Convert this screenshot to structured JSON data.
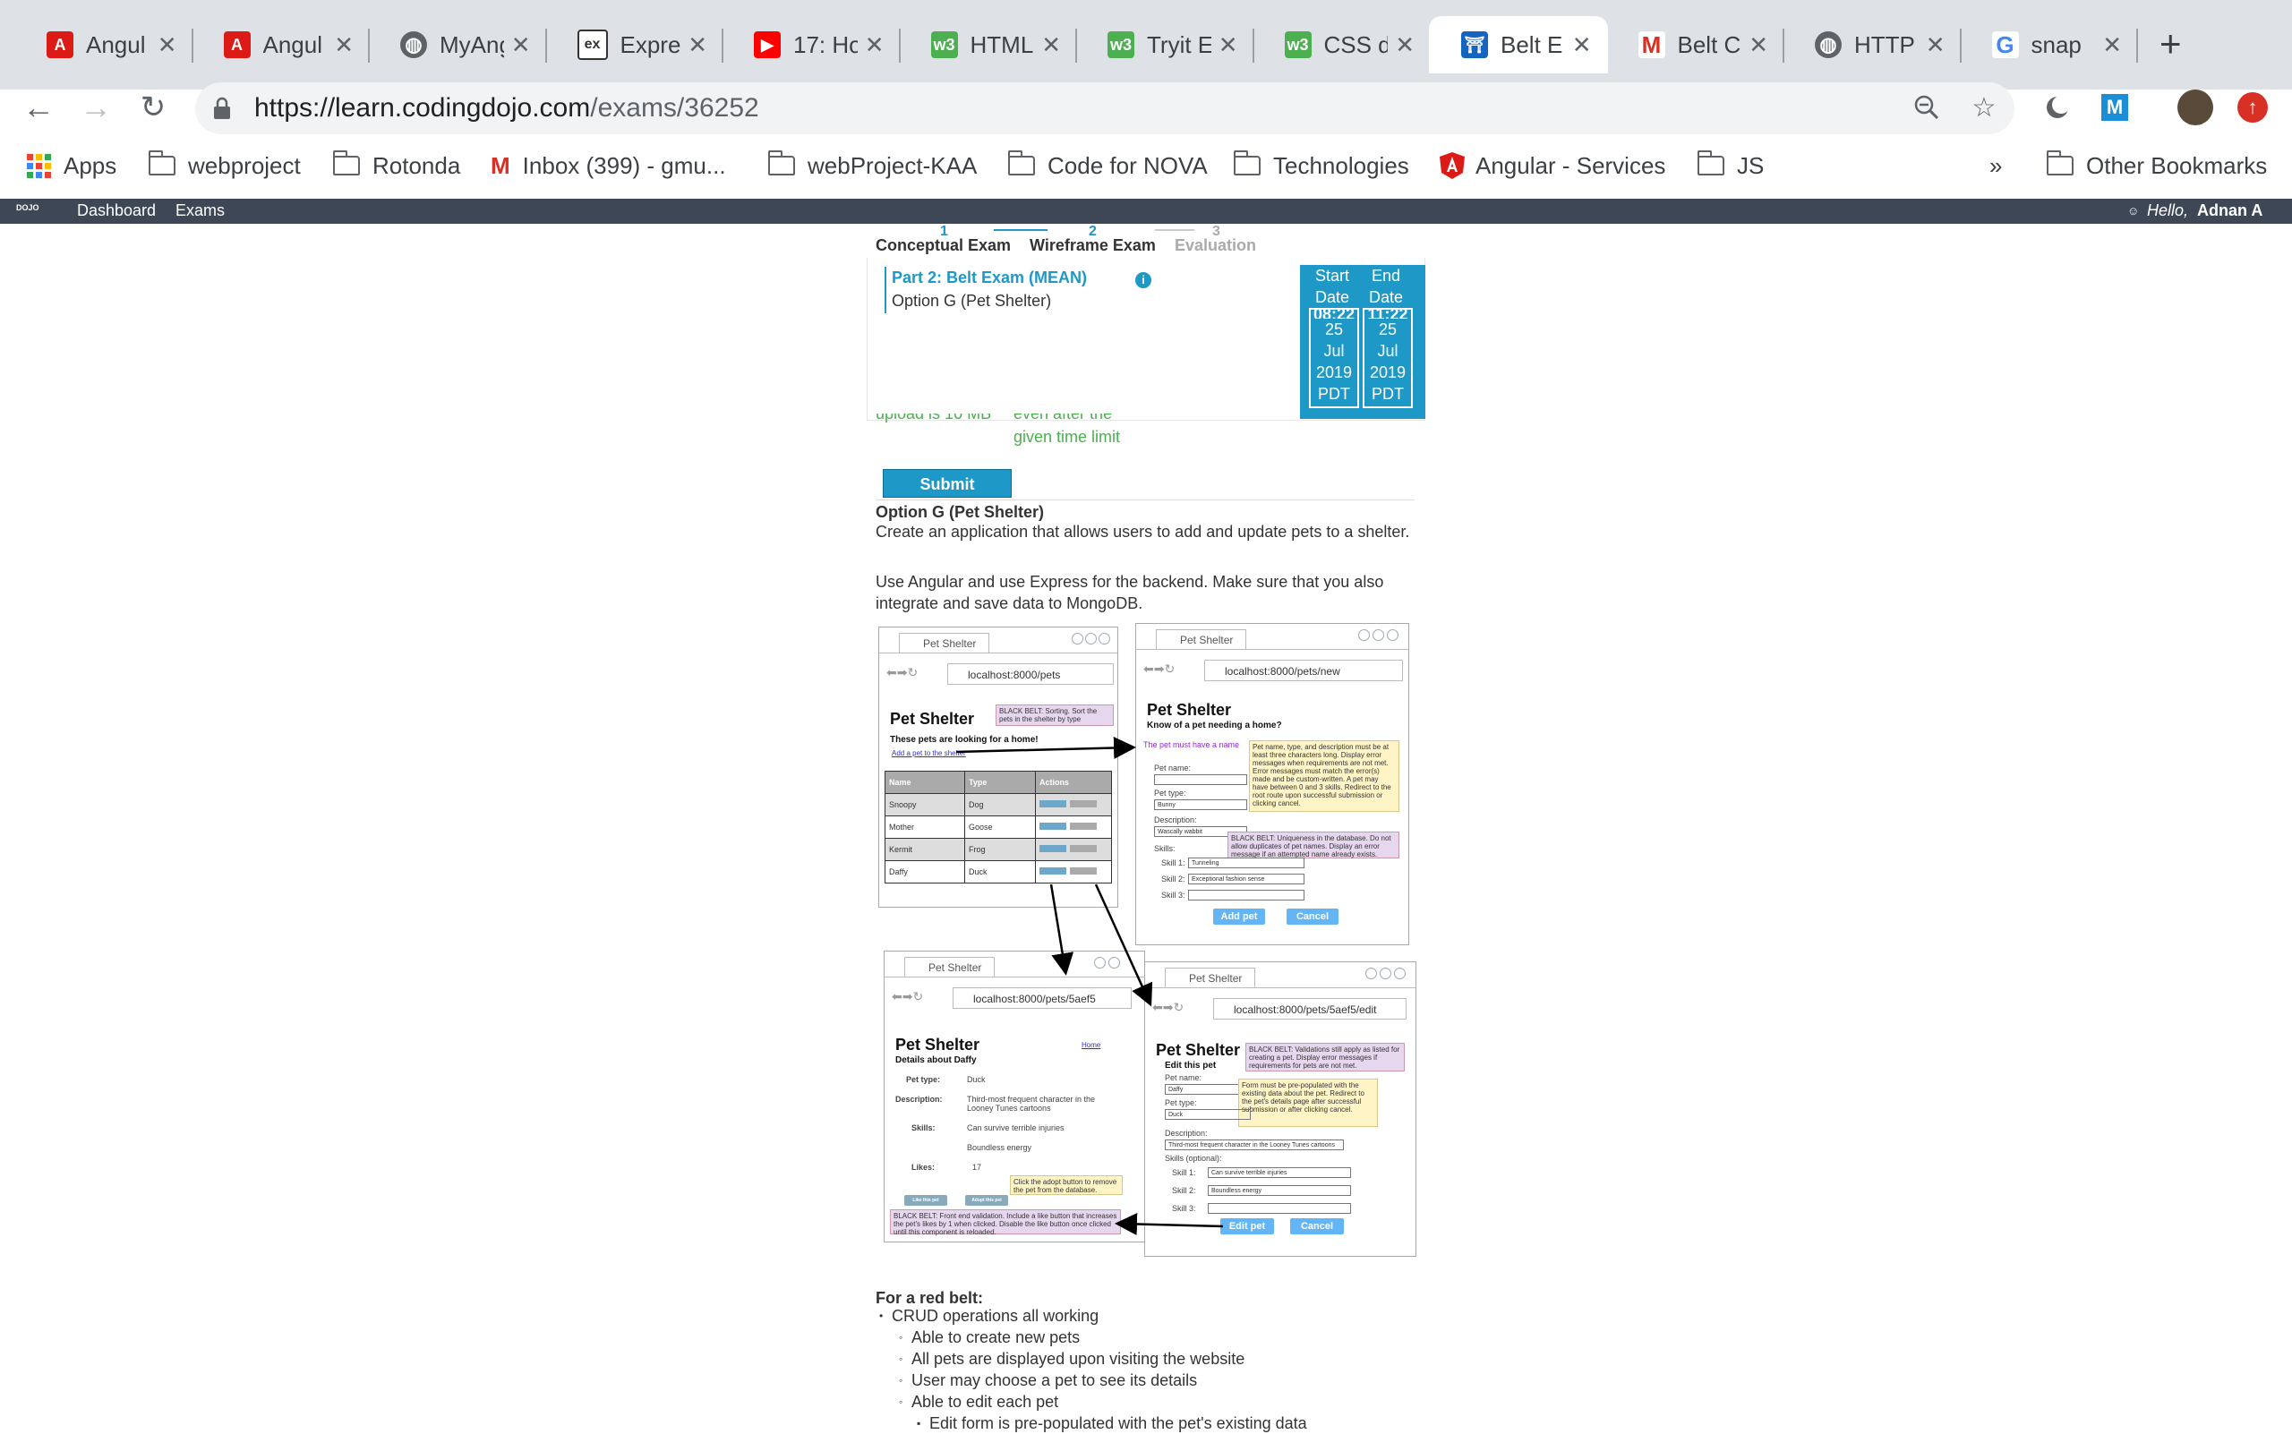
{
  "browser": {
    "tabs": [
      {
        "label": "Angul",
        "icon": "angular-icon"
      },
      {
        "label": "Angul",
        "icon": "angular-icon"
      },
      {
        "label": "MyAng",
        "icon": "globe-icon"
      },
      {
        "label": "Expre",
        "icon": "express-icon"
      },
      {
        "label": "17: Ho",
        "icon": "youtube-icon"
      },
      {
        "label": "HTML",
        "icon": "w3schools-icon"
      },
      {
        "label": "Tryit E",
        "icon": "w3schools-icon"
      },
      {
        "label": "CSS d",
        "icon": "w3schools-icon"
      },
      {
        "label": "Belt E",
        "icon": "codingdojo-icon",
        "active": true
      },
      {
        "label": "Belt C",
        "icon": "gmail-icon"
      },
      {
        "label": "HTTP",
        "icon": "globe-icon"
      },
      {
        "label": "snap",
        "icon": "google-icon"
      }
    ],
    "url": {
      "base": "https://learn.codingdojo.com",
      "path": "/exams/36252"
    },
    "bookmarks": [
      {
        "label": "Apps",
        "icon": "apps-grid-icon"
      },
      {
        "label": "webproject",
        "icon": "folder-icon"
      },
      {
        "label": "Rotonda",
        "icon": "folder-icon"
      },
      {
        "label": "Inbox (399) - gmu...",
        "icon": "gmail-icon"
      },
      {
        "label": "webProject-KAA",
        "icon": "folder-icon"
      },
      {
        "label": "Code for NOVA",
        "icon": "folder-icon"
      },
      {
        "label": "Technologies",
        "icon": "folder-icon"
      },
      {
        "label": "Angular - Services",
        "icon": "angular-icon"
      },
      {
        "label": "JS",
        "icon": "folder-icon"
      }
    ],
    "bookmarks_overflow": "»",
    "other_bookmarks": "Other Bookmarks"
  },
  "appnav": {
    "logo_text": "DOJO",
    "links": [
      "Dashboard",
      "Exams"
    ],
    "greeting": "Hello,",
    "user": "Adnan A"
  },
  "exam": {
    "steps": [
      {
        "num": "1",
        "label": "Conceptual Exam"
      },
      {
        "num": "2",
        "label": "Wireframe Exam"
      },
      {
        "num": "3",
        "label": "Evaluation"
      }
    ],
    "part": "Part 2: Belt Exam (MEAN)",
    "option": "Option G (Pet Shelter)",
    "dates": {
      "start_label_1": "Start",
      "start_label_2": "Date",
      "end_label_1": "End",
      "end_label_2": "Date",
      "start_time": "08:22",
      "end_time": "11:22",
      "start": [
        "25",
        "Jul",
        "2019",
        "PDT"
      ],
      "end": [
        "25",
        "Jul",
        "2019",
        "PDT"
      ]
    },
    "upload_note": "upload is 10 MB",
    "time_note_1": "even after the",
    "time_note_2": "given time limit",
    "submit_label": "Submit",
    "heading": "Option G (Pet Shelter)",
    "desc1": "Create an application that allows users to add and update pets to a shelter.",
    "desc2": "Use Angular and use Express for the backend. Make sure that you also integrate and save data to MongoDB.",
    "red_belt_title": "For a red belt:",
    "red_belt": [
      {
        "level": 1,
        "text": "CRUD operations all working"
      },
      {
        "level": 2,
        "text": "Able to create new pets"
      },
      {
        "level": 2,
        "text": "All pets are displayed upon visiting the website"
      },
      {
        "level": 2,
        "text": "User may choose a pet to see its details"
      },
      {
        "level": 2,
        "text": "Able to edit each pet"
      },
      {
        "level": 3,
        "text": "Edit form is pre-populated with the pet's existing data"
      }
    ]
  },
  "wireframes": {
    "tab_title": "Pet Shelter",
    "list": {
      "url": "localhost:8000/pets",
      "title": "Pet Shelter",
      "subtitle": "These pets are looking for a home!",
      "link": "Add a pet to the shelter",
      "note": "BLACK BELT: Sorting. Sort the pets in the shelter by type",
      "headers": [
        "Name",
        "Type",
        "Actions"
      ],
      "rows": [
        [
          "Snoopy",
          "Dog"
        ],
        [
          "Mother",
          "Goose"
        ],
        [
          "Kermit",
          "Frog"
        ],
        [
          "Daffy",
          "Duck"
        ]
      ]
    },
    "new": {
      "url": "localhost:8000/pets/new",
      "title": "Pet Shelter",
      "subtitle": "Know of a pet needing a home?",
      "error": "The pet must have a name",
      "note_yellow": "Pet name, type, and description must be at least three characters long. Display error messages when requirements are not met. Error messages must match the error(s) made and be custom-written. A pet may have between 0 and 3 skills. Redirect to the root route upon successful submission or clicking cancel.",
      "note_purple": "BLACK BELT: Uniqueness in the database. Do not allow duplicates of pet names. Display an error message if an attempted name already exists.",
      "labels": [
        "Pet name:",
        "Pet type:",
        "Description:",
        "Skills:",
        "Skill 1:",
        "Skill 2:",
        "Skill 3:"
      ],
      "values": [
        "",
        "Bunny",
        "Wascally wabbit",
        "Tunneling",
        "Exceptional fashion sense"
      ],
      "add_btn": "Add pet",
      "cancel_btn": "Cancel"
    },
    "details": {
      "url": "localhost:8000/pets/5aef5",
      "title": "Pet Shelter",
      "home": "Home",
      "subtitle": "Details about Daffy",
      "fields": [
        {
          "k": "Pet type:",
          "v": "Duck"
        },
        {
          "k": "Description:",
          "v": "Third-most frequent character in the Looney Tunes cartoons"
        },
        {
          "k": "Skills:",
          "v": "Can survive terrible injuries"
        },
        {
          "k": "",
          "v": "Boundless energy"
        },
        {
          "k": "Likes:",
          "v": "17"
        }
      ],
      "like_btn": "Like this pet",
      "adopt_btn": "Adopt this pet",
      "note_yellow": "Click the adopt button to remove the pet from the database.",
      "note_purple": "BLACK BELT: Front end validation. Include a like button that increases the pet's likes by 1 when clicked. Disable the like button once clicked until this component is reloaded."
    },
    "edit": {
      "url": "localhost:8000/pets/5aef5/edit",
      "title": "Pet Shelter",
      "subtitle": "Edit this pet",
      "note_purple": "BLACK BELT: Validations still apply as listed for creating a pet. Display error messages if requirements for pets are not met.",
      "note_yellow": "Form must be pre-populated with the existing data about the pet. Redirect to the pet's details page after successful submission or after clicking cancel.",
      "labels": [
        "Pet name:",
        "Pet type:",
        "Description:",
        "Skills (optional):",
        "Skill 1:",
        "Skill 2:",
        "Skill 3:"
      ],
      "values": [
        "Daffy",
        "Duck",
        "Third-most frequent character in the Looney Tunes cartoons",
        "Can survive terrible injuries",
        "Boundless energy"
      ],
      "edit_btn": "Edit pet",
      "cancel_btn": "Cancel"
    }
  }
}
